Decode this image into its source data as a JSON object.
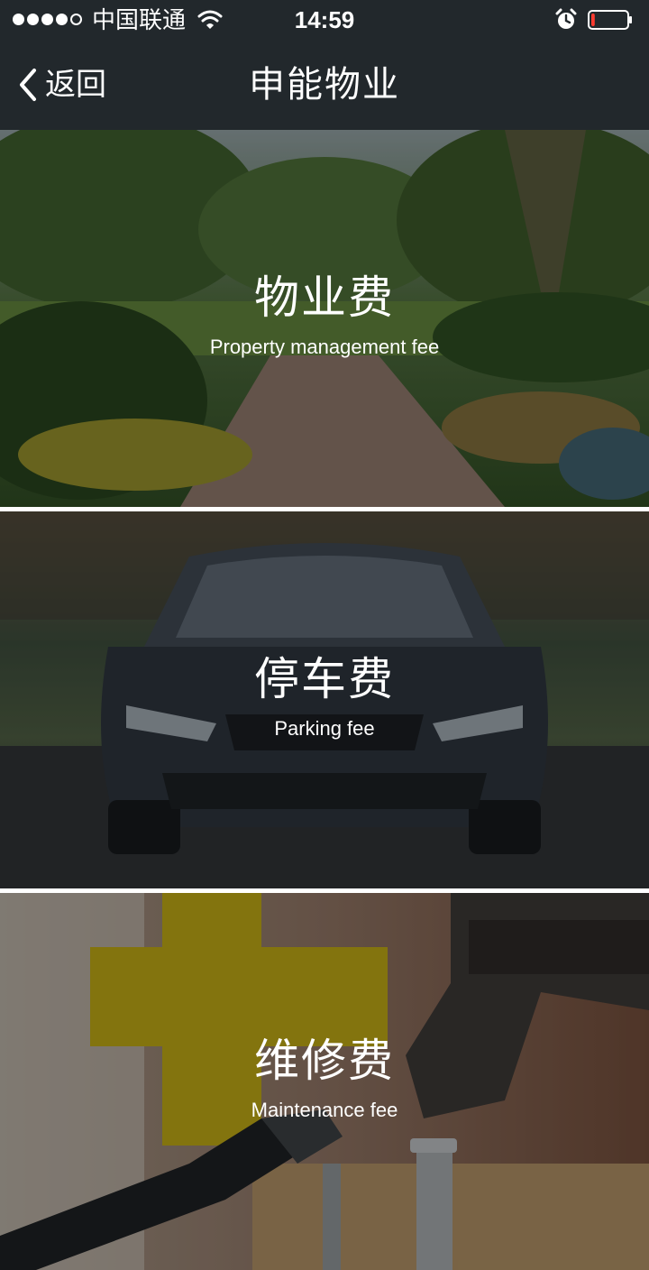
{
  "status_bar": {
    "carrier": "中国联通",
    "time": "14:59",
    "signal_bars_filled": 4,
    "signal_bars_total": 5,
    "icons": [
      "wifi-icon",
      "alarm-icon",
      "battery-icon"
    ],
    "battery_level": 0.1,
    "battery_color": "#ff3b30"
  },
  "nav": {
    "back_label": "返回",
    "title": "申能物业"
  },
  "colors": {
    "header_bg": "#22282c",
    "text": "#ffffff"
  },
  "cards": [
    {
      "title": "物业费",
      "subtitle": "Property management fee"
    },
    {
      "title": "停车费",
      "subtitle": "Parking fee"
    },
    {
      "title": "维修费",
      "subtitle": "Maintenance fee"
    }
  ]
}
